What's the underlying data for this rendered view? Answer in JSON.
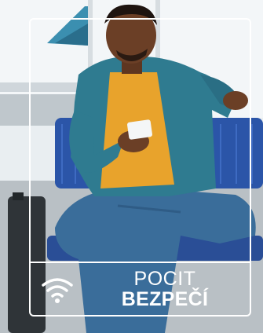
{
  "banner": {
    "line1": "POCIT",
    "line2": "BEZPEČÍ",
    "icon": "wifi-icon"
  },
  "colors": {
    "frame": "#ffffff",
    "shirt": "#e8a32c",
    "jacket": "#2f7b90",
    "seat": "#2b55a8",
    "jeans": "#3a6d9a",
    "skin": "#6b3f26"
  }
}
